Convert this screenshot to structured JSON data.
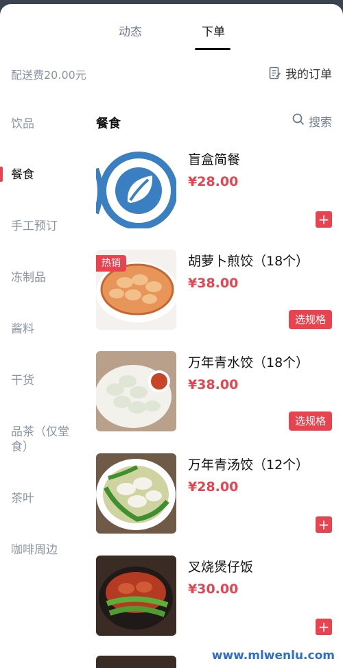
{
  "tabs": [
    {
      "label": "动态",
      "active": false
    },
    {
      "label": "下单",
      "active": true
    }
  ],
  "header": {
    "delivery_fee": "配送费20.00元",
    "my_orders": "我的订单",
    "my_orders_icon": "order-list-icon"
  },
  "categories": [
    {
      "label": "饮品",
      "active": false
    },
    {
      "label": "餐食",
      "active": true
    },
    {
      "label": "手工预订",
      "active": false
    },
    {
      "label": "冻制品",
      "active": false
    },
    {
      "label": "酱料",
      "active": false
    },
    {
      "label": "干货",
      "active": false
    },
    {
      "label": "品茶（仅堂食）",
      "active": false
    },
    {
      "label": "茶叶",
      "active": false
    },
    {
      "label": "咖啡周边",
      "active": false
    }
  ],
  "section": {
    "title": "餐食",
    "search_label": "搜索",
    "search_icon": "search-icon"
  },
  "products": [
    {
      "name": "盲盒简餐",
      "price": "¥28.00",
      "action": "+",
      "badge": ""
    },
    {
      "name": "胡萝卜煎饺（18个）",
      "price": "¥38.00",
      "action": "选规格",
      "badge": "热销"
    },
    {
      "name": "万年青水饺（18个）",
      "price": "¥38.00",
      "action": "选规格",
      "badge": ""
    },
    {
      "name": "万年青汤饺（12个）",
      "price": "¥28.00",
      "action": "+",
      "badge": ""
    },
    {
      "name": "叉烧煲仔饭",
      "price": "¥30.00",
      "action": "+",
      "badge": ""
    }
  ],
  "colors": {
    "accent": "#e8434f",
    "muted_text": "#8a95a3",
    "logo_blue": "#3a7fc1"
  },
  "watermark": "www.mlwenlu.com"
}
